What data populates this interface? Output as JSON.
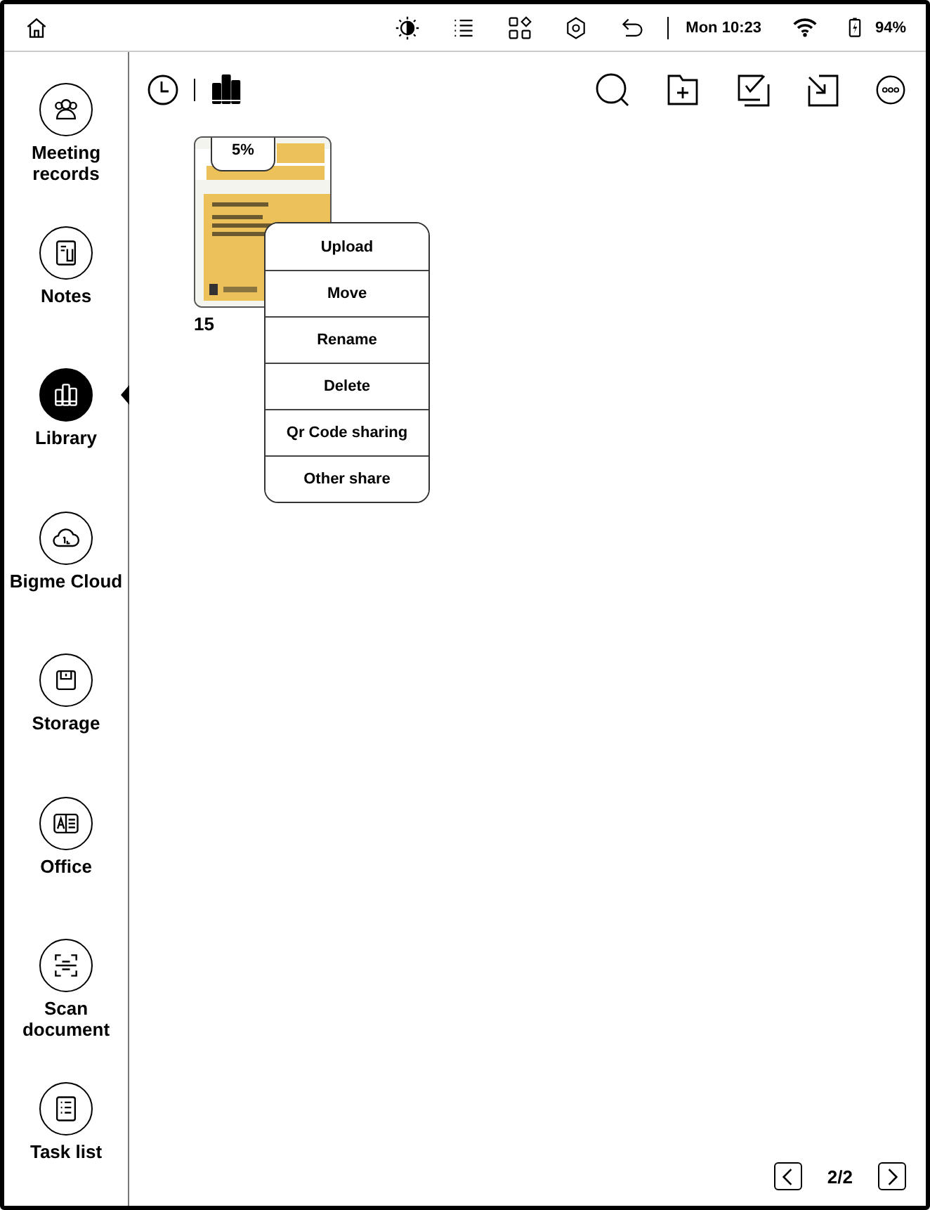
{
  "status_bar": {
    "time": "Mon 10:23",
    "battery": "94%"
  },
  "sidebar": {
    "items": [
      {
        "label": "Meeting records",
        "selected": false
      },
      {
        "label": "Notes",
        "selected": false
      },
      {
        "label": "Library",
        "selected": true
      },
      {
        "label": "Bigme Cloud",
        "selected": false
      },
      {
        "label": "Storage",
        "selected": false
      },
      {
        "label": "Office",
        "selected": false
      },
      {
        "label": "Scan document",
        "selected": false
      },
      {
        "label": "Task list",
        "selected": false
      }
    ]
  },
  "books": [
    {
      "kind": "picture",
      "title": "15",
      "progress": "5%"
    }
  ],
  "context_menu": {
    "items": [
      "Upload",
      "Move",
      "Rename",
      "Delete",
      "Qr Code sharing",
      "Other share"
    ]
  },
  "pagination": {
    "page": "2/2"
  }
}
